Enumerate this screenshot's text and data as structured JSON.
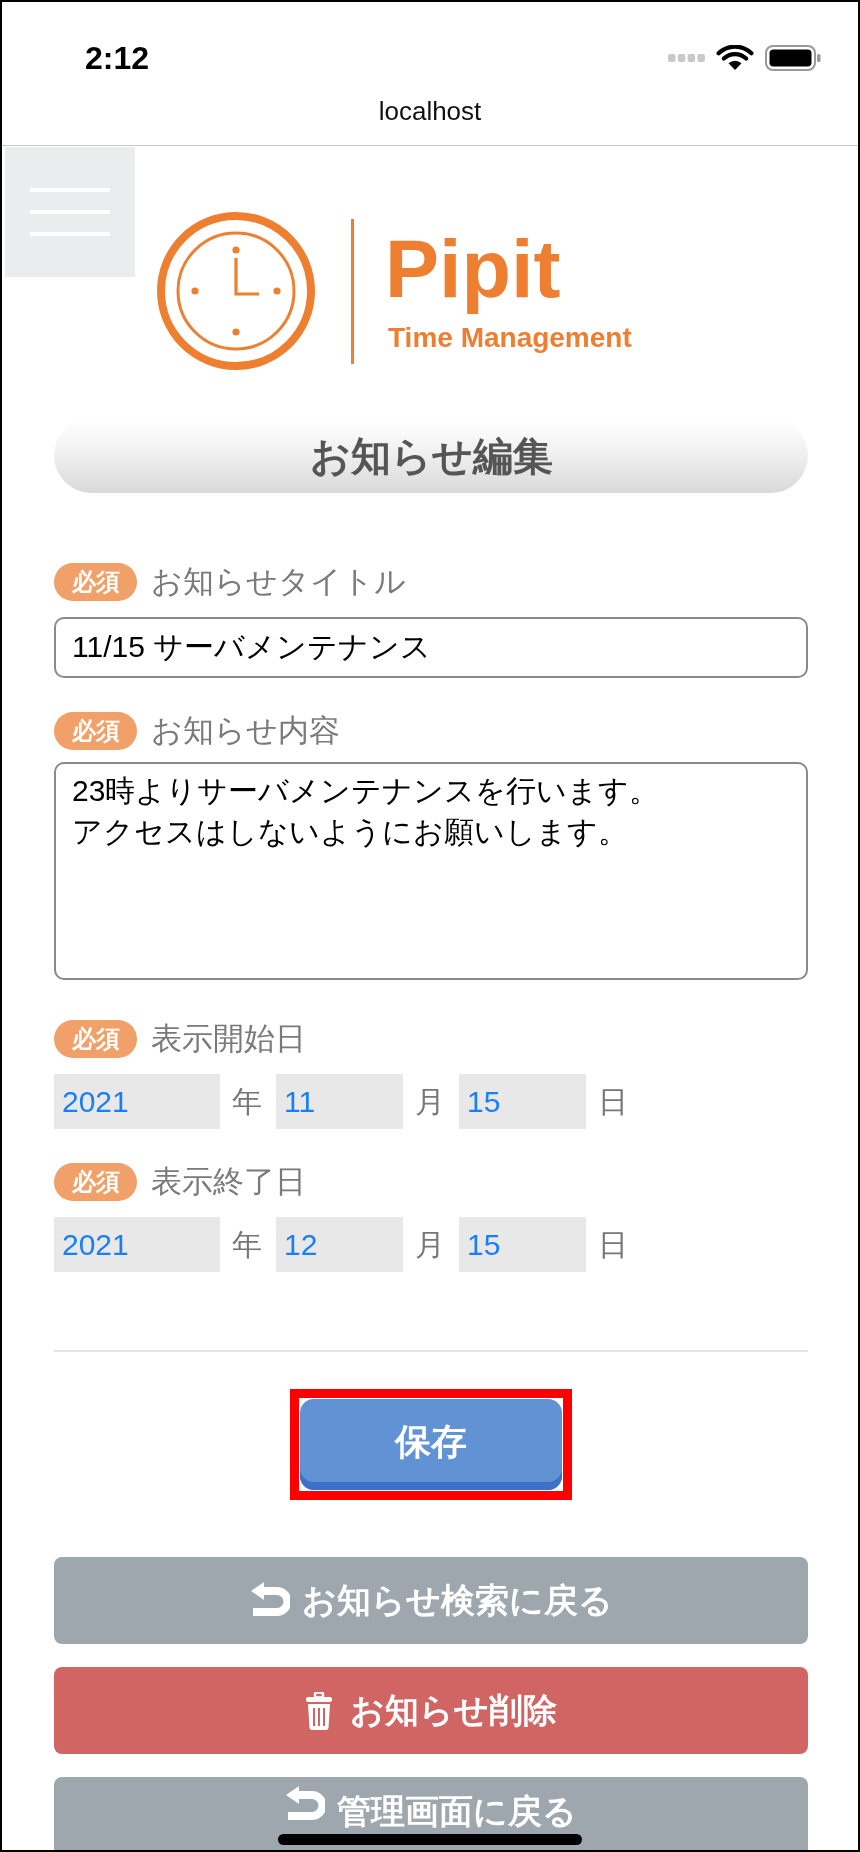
{
  "status_bar": {
    "time": "2:12"
  },
  "address_bar": {
    "url": "localhost"
  },
  "logo": {
    "name": "Pipit",
    "tagline": "Time Management"
  },
  "page_title": "お知らせ編集",
  "fields": [
    {
      "kind": "text",
      "badge": "必須",
      "label": "お知らせタイトル",
      "value": "11/15 サーバメンテナンス"
    },
    {
      "kind": "textarea",
      "badge": "必須",
      "label": "お知らせ内容",
      "lines": [
        "23時よりサーバメンテナンスを行います。",
        "アクセスはしないようにお願いします。"
      ]
    },
    {
      "kind": "date",
      "badge": "必須",
      "label": "表示開始日",
      "parts": [
        {
          "value": "2021",
          "unit": "年"
        },
        {
          "value": "11",
          "unit": "月"
        },
        {
          "value": "15",
          "unit": "日"
        }
      ]
    },
    {
      "kind": "date",
      "badge": "必須",
      "label": "表示終了日",
      "parts": [
        {
          "value": "2021",
          "unit": "年"
        },
        {
          "value": "12",
          "unit": "月"
        },
        {
          "value": "15",
          "unit": "日"
        }
      ]
    }
  ],
  "save_button": {
    "label": "保存",
    "highlighted": true
  },
  "actions": [
    {
      "kind": "back",
      "label": "お知らせ検索に戻る"
    },
    {
      "kind": "delete",
      "label": "お知らせ削除"
    },
    {
      "kind": "back",
      "label": "管理画面に戻る"
    }
  ]
}
